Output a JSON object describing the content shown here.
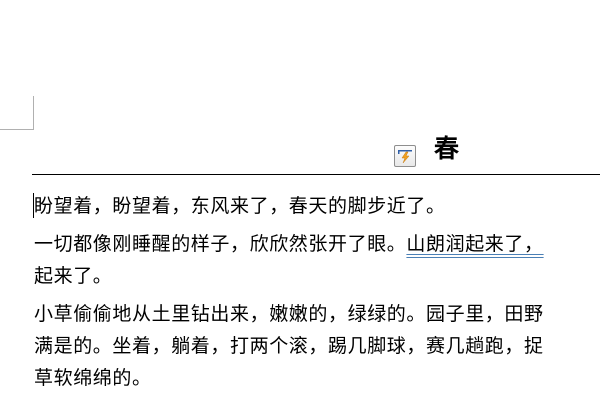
{
  "document": {
    "title": "春",
    "quick_icon": "lightning-format-icon",
    "paragraphs": [
      {
        "lines": [
          "盼望着，盼望着，东风来了，春天的脚步近了。"
        ]
      },
      {
        "lines_a": "一切都像刚睡醒的样子，欣欣然张开了眼。",
        "lines_link": "山朗润起来了，",
        "lines_b": "起来了。"
      },
      {
        "lines": [
          "小草偷偷地从土里钻出来，嫩嫩的，绿绿的。园子里，田野",
          "满是的。坐着，躺着，打两个滚，踢几脚球，赛几趟跑，捉",
          "草软绵绵的。"
        ]
      }
    ]
  },
  "colors": {
    "text": "#000000",
    "underline": "#4a7fb5",
    "rule": "#000000"
  }
}
